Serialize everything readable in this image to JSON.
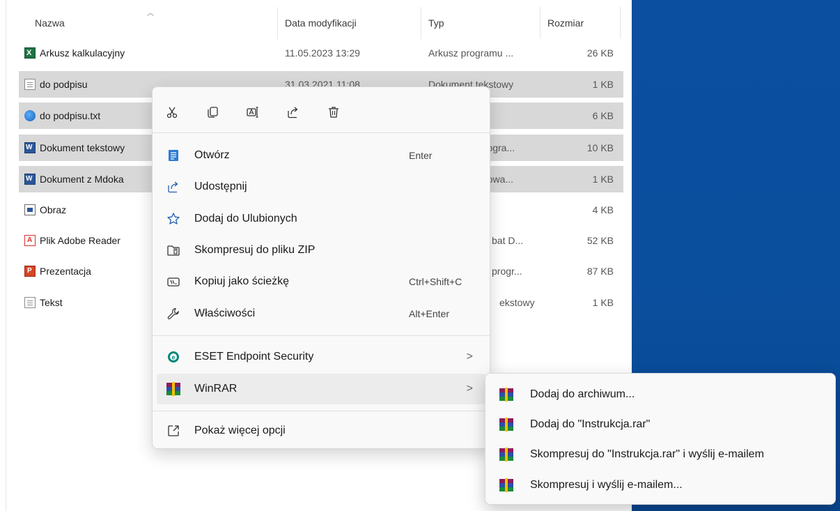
{
  "columns": {
    "name": "Nazwa",
    "date": "Data modyfikacji",
    "type": "Typ",
    "size": "Rozmiar"
  },
  "files": [
    {
      "name": "Arkusz kalkulacyjny",
      "date": "11.05.2023 13:29",
      "type": "Arkusz programu ...",
      "size": "26 KB",
      "icon": "excel-icon"
    },
    {
      "name": "do podpisu",
      "date": "31.03.2021 11:08",
      "type": "Dokument tekstowy",
      "size": "1 KB",
      "icon": "text-document-icon"
    },
    {
      "name": "do podpisu.txt",
      "date": "",
      "type": "",
      "size": "6 KB",
      "icon": "web-text-icon"
    },
    {
      "name": "Dokument tekstowy",
      "date": "",
      "type": "progra...",
      "size": "10 KB",
      "icon": "word-icon"
    },
    {
      "name": "Dokument z Mdoka",
      "date": "",
      "type": "atowa...",
      "size": "1 KB",
      "icon": "word-icon"
    },
    {
      "name": "Obraz",
      "date": "",
      "type": "",
      "size": "4 KB",
      "icon": "image-icon"
    },
    {
      "name": "Plik Adobe Reader",
      "date": "",
      "type": "bat D...",
      "size": "52 KB",
      "icon": "pdf-icon"
    },
    {
      "name": "Prezentacja",
      "date": "",
      "type": "progr...",
      "size": "87 KB",
      "icon": "powerpoint-icon"
    },
    {
      "name": "Tekst",
      "date": "",
      "type": "ekstowy",
      "size": "1 KB",
      "icon": "text-document-icon"
    }
  ],
  "context_menu": {
    "quick_actions": [
      "cut-icon",
      "copy-icon",
      "rename-icon",
      "share-icon",
      "delete-icon"
    ],
    "items": [
      {
        "label": "Otwórz",
        "shortcut": "Enter",
        "icon": "open-icon"
      },
      {
        "label": "Udostępnij",
        "shortcut": "",
        "icon": "share-icon"
      },
      {
        "label": "Dodaj do Ulubionych",
        "shortcut": "",
        "icon": "star-icon"
      },
      {
        "label": "Skompresuj do pliku ZIP",
        "shortcut": "",
        "icon": "zip-icon"
      },
      {
        "label": "Kopiuj jako ścieżkę",
        "shortcut": "Ctrl+Shift+C",
        "icon": "copy-path-icon"
      },
      {
        "label": "Właściwości",
        "shortcut": "Alt+Enter",
        "icon": "wrench-icon"
      }
    ],
    "eset": {
      "label": "ESET Endpoint Security",
      "arrow": ">"
    },
    "winrar": {
      "label": "WinRAR",
      "arrow": ">"
    },
    "more": {
      "label": "Pokaż więcej opcji"
    }
  },
  "winrar_submenu": [
    {
      "label": "Dodaj do archiwum..."
    },
    {
      "label": "Dodaj do \"Instrukcja.rar\""
    },
    {
      "label": "Skompresuj do \"Instrukcja.rar\" i wyślij e-mailem"
    },
    {
      "label": "Skompresuj i wyślij e-mailem..."
    }
  ]
}
